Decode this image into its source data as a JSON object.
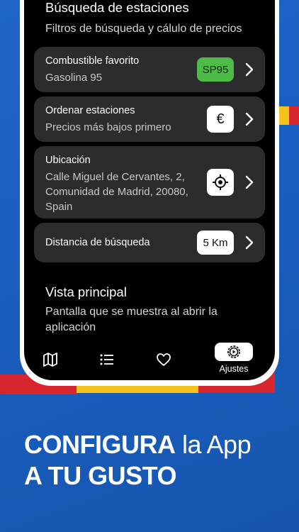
{
  "search_section": {
    "title": "Búsqueda de estaciones",
    "subtitle": "Filtros de búsqueda y cálulo de precios"
  },
  "settings": [
    {
      "title": "Combustible favorito",
      "value": "Gasolina 95",
      "badge": "SP95"
    },
    {
      "title": "Ordenar estaciones",
      "value": "Precios más bajos primero",
      "badge_icon": "euro-icon",
      "badge": "€"
    },
    {
      "title": "Ubicación",
      "value_lines": [
        "Calle Miguel de Cervantes, 2,",
        "Comunidad de Madrid, 20080,",
        "Spain"
      ],
      "badge_icon": "crosshair-icon"
    },
    {
      "title": "Distancia de búsqueda",
      "badge": "5 Km"
    }
  ],
  "main_view_section": {
    "title": "Vista principal",
    "subtitle_lines": [
      "Pantalla que se muestra al abrir la",
      "aplicación"
    ]
  },
  "navbar": {
    "items": [
      {
        "icon": "map-icon"
      },
      {
        "icon": "list-icon"
      },
      {
        "icon": "heart-icon"
      },
      {
        "icon": "settings-icon",
        "label": "Ajustes",
        "active": true
      }
    ]
  },
  "promo": {
    "line1_bold": "CONFIGURA",
    "line1_light": " la App",
    "line2": "A TU GUSTO"
  },
  "colors": {
    "background": "#1a5fbf",
    "card": "#2c2c2e",
    "badge_green": "#4dbb47",
    "flag_red": "#d8262e",
    "flag_yellow": "#f4c21b"
  }
}
